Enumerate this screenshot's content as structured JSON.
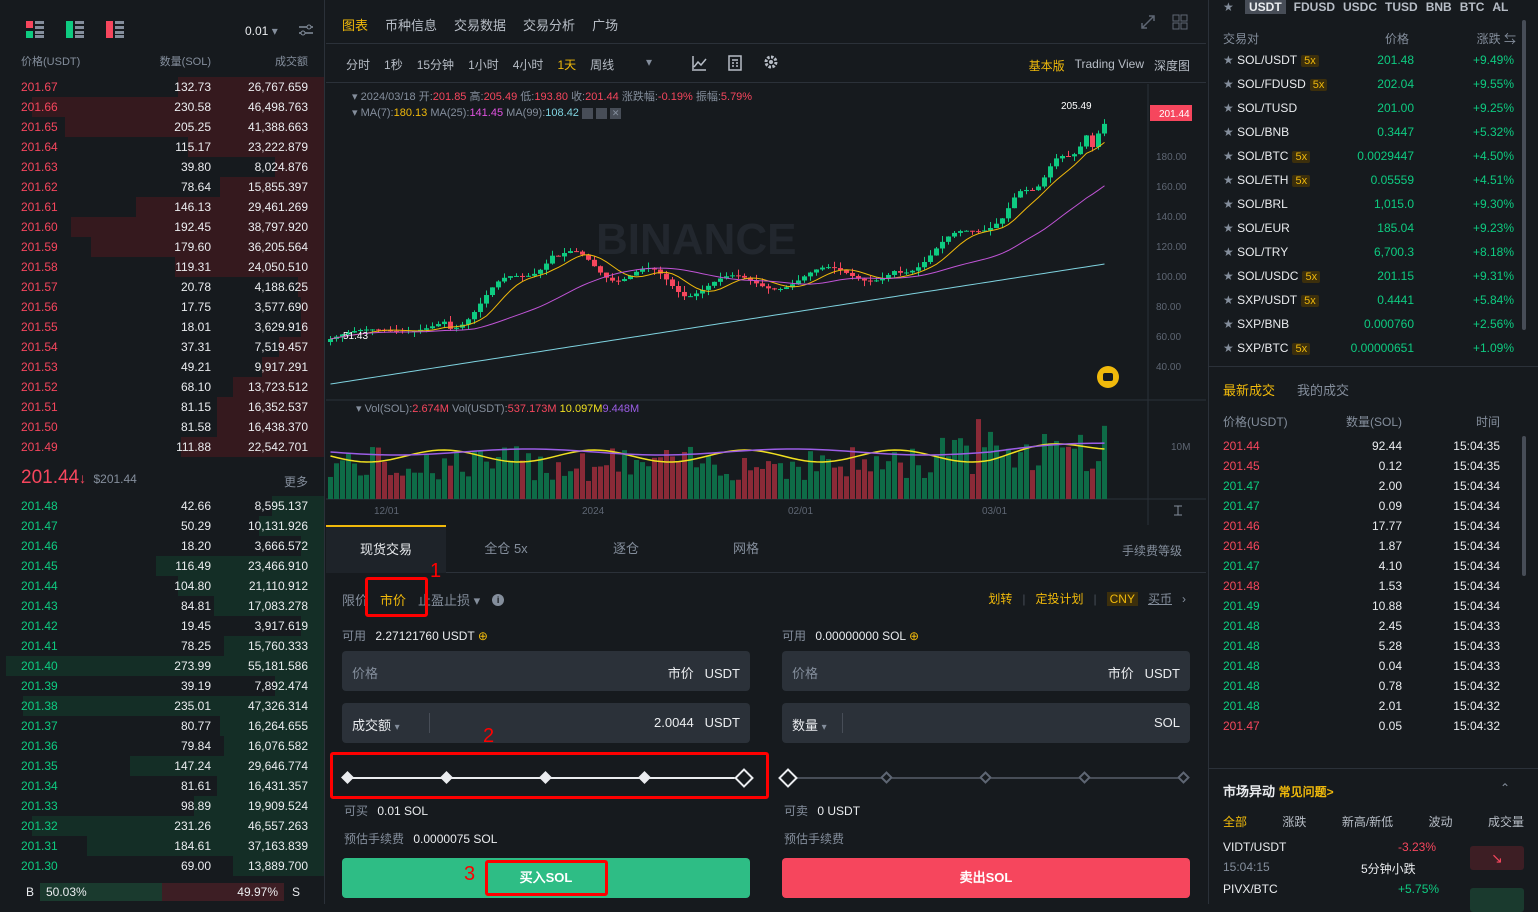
{
  "orderbook": {
    "tick": "0.01",
    "headers": [
      "价格(USDT)",
      "数量(SOL)",
      "成交额"
    ],
    "asks": [
      [
        "201.67",
        "132.73",
        "26,767.659",
        0.45
      ],
      [
        "201.66",
        "230.58",
        "46,498.763",
        0.9
      ],
      [
        "201.65",
        "205.25",
        "41,388.663",
        0.8
      ],
      [
        "201.64",
        "115.17",
        "23,222.879",
        0.42
      ],
      [
        "201.63",
        "39.80",
        "8,024.876",
        0.15
      ],
      [
        "201.62",
        "78.64",
        "15,855.397",
        0.32
      ],
      [
        "201.61",
        "146.13",
        "29,461.269",
        0.58
      ],
      [
        "201.60",
        "192.45",
        "38,797.920",
        0.78
      ],
      [
        "201.59",
        "179.60",
        "36,205.564",
        0.72
      ],
      [
        "201.58",
        "119.31",
        "24,050.510",
        0.46
      ],
      [
        "201.57",
        "20.78",
        "4,188.625",
        0.08
      ],
      [
        "201.56",
        "17.75",
        "3,577.690",
        0.07
      ],
      [
        "201.55",
        "18.01",
        "3,629.916",
        0.07
      ],
      [
        "201.54",
        "37.31",
        "7,519.457",
        0.14
      ],
      [
        "201.53",
        "49.21",
        "9,917.291",
        0.19
      ],
      [
        "201.52",
        "68.10",
        "13,723.512",
        0.28
      ],
      [
        "201.51",
        "81.15",
        "16,352.537",
        0.33
      ],
      [
        "201.50",
        "81.58",
        "16,438.370",
        0.33
      ],
      [
        "201.49",
        "111.88",
        "22,542.701",
        0.44
      ]
    ],
    "last_price": "201.44",
    "last_arrow": "↓",
    "last_usd": "$201.44",
    "more": "更多",
    "bids": [
      [
        "201.48",
        "42.66",
        "8,595.137",
        0.16
      ],
      [
        "201.47",
        "50.29",
        "10,131.926",
        0.2
      ],
      [
        "201.46",
        "18.20",
        "3,666.572",
        0.07
      ],
      [
        "201.45",
        "116.49",
        "23,466.910",
        0.52
      ],
      [
        "201.44",
        "104.80",
        "21,110.912",
        0.45
      ],
      [
        "201.43",
        "84.81",
        "17,083.278",
        0.34
      ],
      [
        "201.42",
        "19.45",
        "3,917.619",
        0.07
      ],
      [
        "201.41",
        "78.25",
        "15,760.333",
        0.31
      ],
      [
        "201.40",
        "273.99",
        "55,181.586",
        0.98
      ],
      [
        "201.39",
        "39.19",
        "7,892.474",
        0.15
      ],
      [
        "201.38",
        "235.01",
        "47,326.314",
        0.93
      ],
      [
        "201.37",
        "80.77",
        "16,264.655",
        0.32
      ],
      [
        "201.36",
        "79.84",
        "16,076.582",
        0.31
      ],
      [
        "201.35",
        "147.24",
        "29,646.774",
        0.6
      ],
      [
        "201.34",
        "81.61",
        "16,431.357",
        0.33
      ],
      [
        "201.33",
        "98.89",
        "19,909.524",
        0.4
      ],
      [
        "201.32",
        "231.26",
        "46,557.263",
        0.9
      ],
      [
        "201.31",
        "184.61",
        "37,163.839",
        0.73
      ],
      [
        "201.30",
        "69.00",
        "13,889.700",
        0.28
      ]
    ],
    "ratio_b": "B",
    "ratio_buy": "50.03%",
    "ratio_sell": "49.97%",
    "ratio_s": "S",
    "ratio_buy_fraction": 0.5003
  },
  "top_tabs": [
    "图表",
    "币种信息",
    "交易数据",
    "交易分析",
    "广场"
  ],
  "intervals": [
    "分时",
    "1秒",
    "15分钟",
    "1小时",
    "4小时",
    "1天",
    "周线"
  ],
  "active_interval": "1天",
  "views": [
    "基本版",
    "Trading View",
    "深度图"
  ],
  "ohlc": {
    "date": "2024/03/18",
    "open_l": "开:",
    "open": "201.85",
    "high_l": "高:",
    "high": "205.49",
    "low_l": "低:",
    "low": "193.80",
    "close_l": "收:",
    "close": "201.44",
    "chg_l": "涨跌幅:",
    "chg": "-0.19%",
    "amp_l": "振幅:",
    "amp": "5.79%"
  },
  "ma": {
    "ma7_l": "MA(7):",
    "ma7": "180.13",
    "ma25_l": "MA(25):",
    "ma25": "141.45",
    "ma99_l": "MA(99):",
    "ma99": "108.42"
  },
  "price_axis": [
    "180.00",
    "160.00",
    "140.00",
    "120.00",
    "100.00",
    "80.00",
    "60.00",
    "40.00"
  ],
  "price_tag": "201.44",
  "high_label": "205.49",
  "low_label": "51.43",
  "watermark": "BINANCE",
  "vol": {
    "sol_l": "Vol(SOL):",
    "sol": "2.674M",
    "usdt_l": "Vol(USDT):",
    "usdt": "537.173M",
    "v1": "10.097M",
    "v2": "9.448M",
    "axis": "10M"
  },
  "date_axis": [
    "12/01",
    "2024",
    "02/01",
    "03/01"
  ],
  "trade_tabs": [
    "现货交易",
    "全仓 5x",
    "逐仓",
    "网格"
  ],
  "fee_link": "手续费等级",
  "order_types": {
    "limit": "限价",
    "market": "市价",
    "stop": "止盈止损"
  },
  "links": {
    "transfer": "划转",
    "plan": "定投计划",
    "cny": "CNY",
    "buy_coin": "买币"
  },
  "buy": {
    "avail_l": "可用",
    "avail": "2.27121760 USDT",
    "price_ph": "价格",
    "market": "市价",
    "unit": "USDT",
    "amt_label": "成交额",
    "amt": "2.0044",
    "amt_unit": "USDT",
    "can_l": "可买",
    "can": "0.01 SOL",
    "fee_l": "预估手续费",
    "fee": "0.0000075 SOL",
    "btn": "买入SOL",
    "slider": 1.0
  },
  "sell": {
    "avail_l": "可用",
    "avail": "0.00000000 SOL",
    "price_ph": "价格",
    "market": "市价",
    "unit": "USDT",
    "amt_label": "数量",
    "amt_unit": "SOL",
    "can_l": "可卖",
    "can": "0 USDT",
    "fee_l": "预估手续费",
    "btn": "卖出SOL",
    "slider": 0.0
  },
  "annotations": [
    "1",
    "2",
    "3"
  ],
  "quote_tabs": [
    "USDT",
    "FDUSD",
    "USDC",
    "TUSD",
    "BNB",
    "BTC",
    "AL"
  ],
  "pair_headers": [
    "交易对",
    "价格",
    "涨跌"
  ],
  "pairs": [
    [
      "SOL/USDT",
      "5x",
      "201.48",
      "+9.49%"
    ],
    [
      "SOL/FDUSD",
      "5x",
      "202.04",
      "+9.55%"
    ],
    [
      "SOL/TUSD",
      "",
      "201.00",
      "+9.25%"
    ],
    [
      "SOL/BNB",
      "",
      "0.3447",
      "+5.32%"
    ],
    [
      "SOL/BTC",
      "5x",
      "0.0029447",
      "+4.50%"
    ],
    [
      "SOL/ETH",
      "5x",
      "0.05559",
      "+4.51%"
    ],
    [
      "SOL/BRL",
      "",
      "1,015.0",
      "+9.30%"
    ],
    [
      "SOL/EUR",
      "",
      "185.04",
      "+9.23%"
    ],
    [
      "SOL/TRY",
      "",
      "6,700.3",
      "+8.18%"
    ],
    [
      "SOL/USDC",
      "5x",
      "201.15",
      "+9.31%"
    ],
    [
      "SXP/USDT",
      "5x",
      "0.4441",
      "+5.84%"
    ],
    [
      "SXP/BNB",
      "",
      "0.000760",
      "+2.56%"
    ],
    [
      "SXP/BTC",
      "5x",
      "0.00000651",
      "+1.09%"
    ]
  ],
  "trades_tabs": [
    "最新成交",
    "我的成交"
  ],
  "trades_headers": [
    "价格(USDT)",
    "数量(SOL)",
    "时间"
  ],
  "trades": [
    [
      "201.44",
      "92.44",
      "15:04:35",
      "r"
    ],
    [
      "201.45",
      "0.12",
      "15:04:35",
      "r"
    ],
    [
      "201.47",
      "2.00",
      "15:04:34",
      "g"
    ],
    [
      "201.47",
      "0.09",
      "15:04:34",
      "g"
    ],
    [
      "201.46",
      "17.77",
      "15:04:34",
      "r"
    ],
    [
      "201.46",
      "1.87",
      "15:04:34",
      "r"
    ],
    [
      "201.47",
      "4.10",
      "15:04:34",
      "g"
    ],
    [
      "201.48",
      "1.53",
      "15:04:34",
      "r"
    ],
    [
      "201.49",
      "10.88",
      "15:04:34",
      "g"
    ],
    [
      "201.48",
      "2.45",
      "15:04:33",
      "g"
    ],
    [
      "201.48",
      "5.28",
      "15:04:33",
      "g"
    ],
    [
      "201.48",
      "0.04",
      "15:04:33",
      "g"
    ],
    [
      "201.48",
      "0.78",
      "15:04:32",
      "g"
    ],
    [
      "201.48",
      "2.01",
      "15:04:32",
      "g"
    ],
    [
      "201.47",
      "0.05",
      "15:04:32",
      "r"
    ]
  ],
  "movers": {
    "title": "市场异动",
    "faq": "常见问题>",
    "tabs": [
      "全部",
      "涨跌",
      "新高/新低",
      "波动",
      "成交量"
    ],
    "items": [
      [
        "VIDT/USDT",
        "-3.23%",
        "15:04:15",
        "5分钟小跌"
      ],
      [
        "PIVX/BTC",
        "+5.75%"
      ]
    ]
  }
}
